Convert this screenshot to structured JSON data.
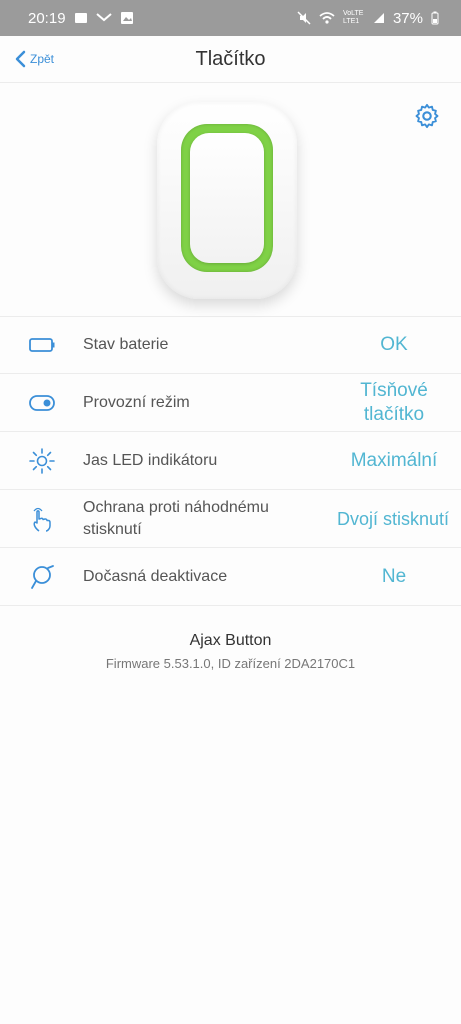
{
  "statusbar": {
    "time": "20:19",
    "battery": "37%",
    "network": "VoLTE LTE1"
  },
  "navbar": {
    "back_label": "Zpět",
    "title": "Tlačítko"
  },
  "rows": [
    {
      "label": "Stav baterie",
      "value": "OK",
      "icon": "battery-icon"
    },
    {
      "label": "Provozní režim",
      "value": "Tísňové tlačítko",
      "icon": "toggle-icon"
    },
    {
      "label": "Jas LED indikátoru",
      "value": "Maximální",
      "icon": "brightness-icon"
    },
    {
      "label": "Ochrana proti náhodnému stisknutí",
      "value": "Dvojí stisknutí",
      "icon": "touch-icon"
    },
    {
      "label": "Dočasná deaktivace",
      "value": "Ne",
      "icon": "deactivate-icon"
    }
  ],
  "device": {
    "name": "Ajax Button",
    "firmware": "Firmware 5.53.1.0, ID zařízení 2DA2170C1"
  },
  "colors": {
    "accent": "#52b6d2",
    "link": "#3b8fd8",
    "ring": "#7fd146"
  }
}
